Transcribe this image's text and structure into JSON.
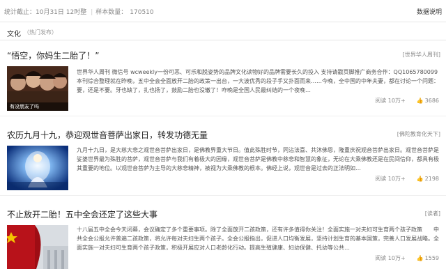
{
  "topbar": {
    "stat_time": "统计截止：10月31日 12时整",
    "stat_count_label": "样本数量：",
    "stat_count_value": "170510",
    "help": "数据说明"
  },
  "section": {
    "category": "文化",
    "subcategory": "（热门发布）"
  },
  "articles": [
    {
      "title": "“悟空，你妈生二胎了！”",
      "source": "[世界华人周刊]",
      "summary": "世界华人周刊 微信号 wcweekly一份可恶、可乐和脱姿势的品牌文化读物好的品牌需要长久的投入 支持请戳页脚推广商务合作：QQ1065780099本刊综合整理就在昨晚，五中全会全面放开二胎的政策一出台，一大波优秀的段子手又扑面而来……今晚，全中国的中年夫妻，都在讨论一个问题：要，还是不要。牙也缺了，扎也扬了，鼓励二胎也没辙了！咋晚是全国人民最纠结的一个夜晚…",
      "thumb_caption": "有没朋友了吗",
      "reads": "阅读 10万+",
      "likes": "3686"
    },
    {
      "title": "农历九月十九，恭迎观世音菩萨出家日，转发功德无量",
      "source": "[佛陀教育化天下]",
      "summary": "九月十九日，是大慈大悲之观世音菩萨出家日，是佛教界重大节日。值此殊胜时节，同沾法喜、共沐佛恩，隆重庆祝观音菩萨出家日。观世音菩萨是娑婆世界最为殊胜的菩萨，观世音菩萨与我们有着极大的因缘，观世音菩萨是佛教中慈悲和智慧的象征，无论在大乘佛教还是在民间信仰，都具有极其重要的地位。以观世音菩萨为主导的大慈悲精神，被视为大乘佛教的根本。佛经上说，观世音是过去的正法明如…",
      "reads": "阅读 10万+",
      "likes": "2198"
    },
    {
      "title": "不止放开二胎！五中全会还定了这些大事",
      "source": "[读者]",
      "summary": "十八届五中全会今天闭幕，会议确定了多个重要事项。除了全面放开二孩政策，还有许多值得你关注！全面实施一对夫妇可生育两个孩子政策　　中共全会公报允许普遍二孩政策，将允许每对夫妇生两个孩子。全会公报指出，促进人口均衡发展，坚持计划生育的基本国策，完善人口发展战略。全面实施一对夫妇可生育两个孩子政策，积极开展应对人口老龄化行动。提高生殖健康、妇幼保健、托幼等公共…",
      "reads": "阅读 10万+",
      "likes": "1559"
    }
  ],
  "colors": {
    "text": "#333333",
    "muted": "#888888",
    "border": "#e6e6e6"
  }
}
